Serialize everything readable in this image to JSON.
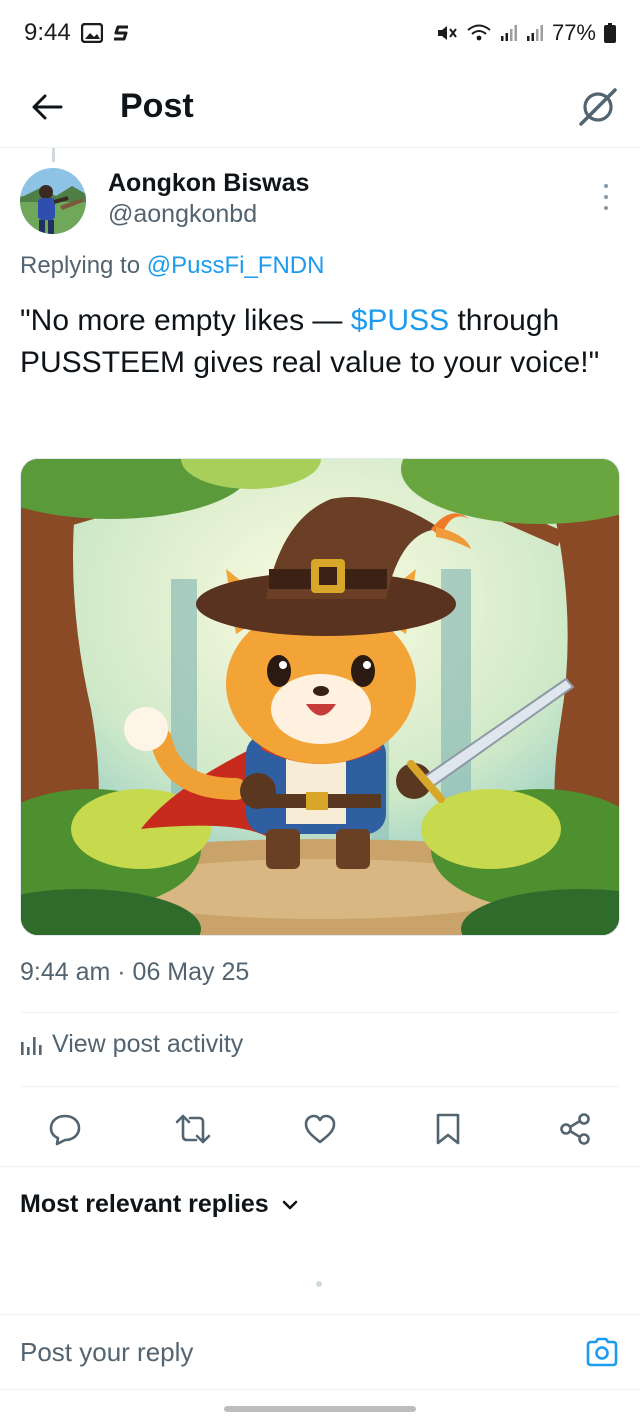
{
  "status_bar": {
    "time": "9:44",
    "battery": "77%",
    "icons": [
      "gallery-icon",
      "s-app-icon",
      "mute-icon",
      "wifi-icon",
      "signal-icon",
      "signal-icon",
      "battery-icon"
    ]
  },
  "header": {
    "title": "Post",
    "back_icon": "arrow-left-icon",
    "grok_icon": "grok-icon"
  },
  "post": {
    "author_name": "Aongkon Biswas",
    "author_handle": "@aongkonbd",
    "replying_prefix": "Replying to ",
    "replying_to": "@PussFi_FNDN",
    "text_part1": "\"No more empty likes — ",
    "cashtag": "$PUSS",
    "text_part2": " through PUSSTEEM gives real value to your voice!\"",
    "image_subject": "cartoon cat adventurer with wizard hat, red cape and sword in a forest",
    "timestamp": "9:44 am · 06 May 25",
    "activity_label": "View post activity"
  },
  "actions": [
    "reply-icon",
    "retweet-icon",
    "like-icon",
    "bookmark-icon",
    "share-icon"
  ],
  "replies": {
    "sort_label": "Most relevant replies"
  },
  "composer": {
    "placeholder": "Post your reply"
  },
  "colors": {
    "accent": "#1d9bf0",
    "secondary_text": "#536471",
    "primary_text": "#0f1419"
  }
}
